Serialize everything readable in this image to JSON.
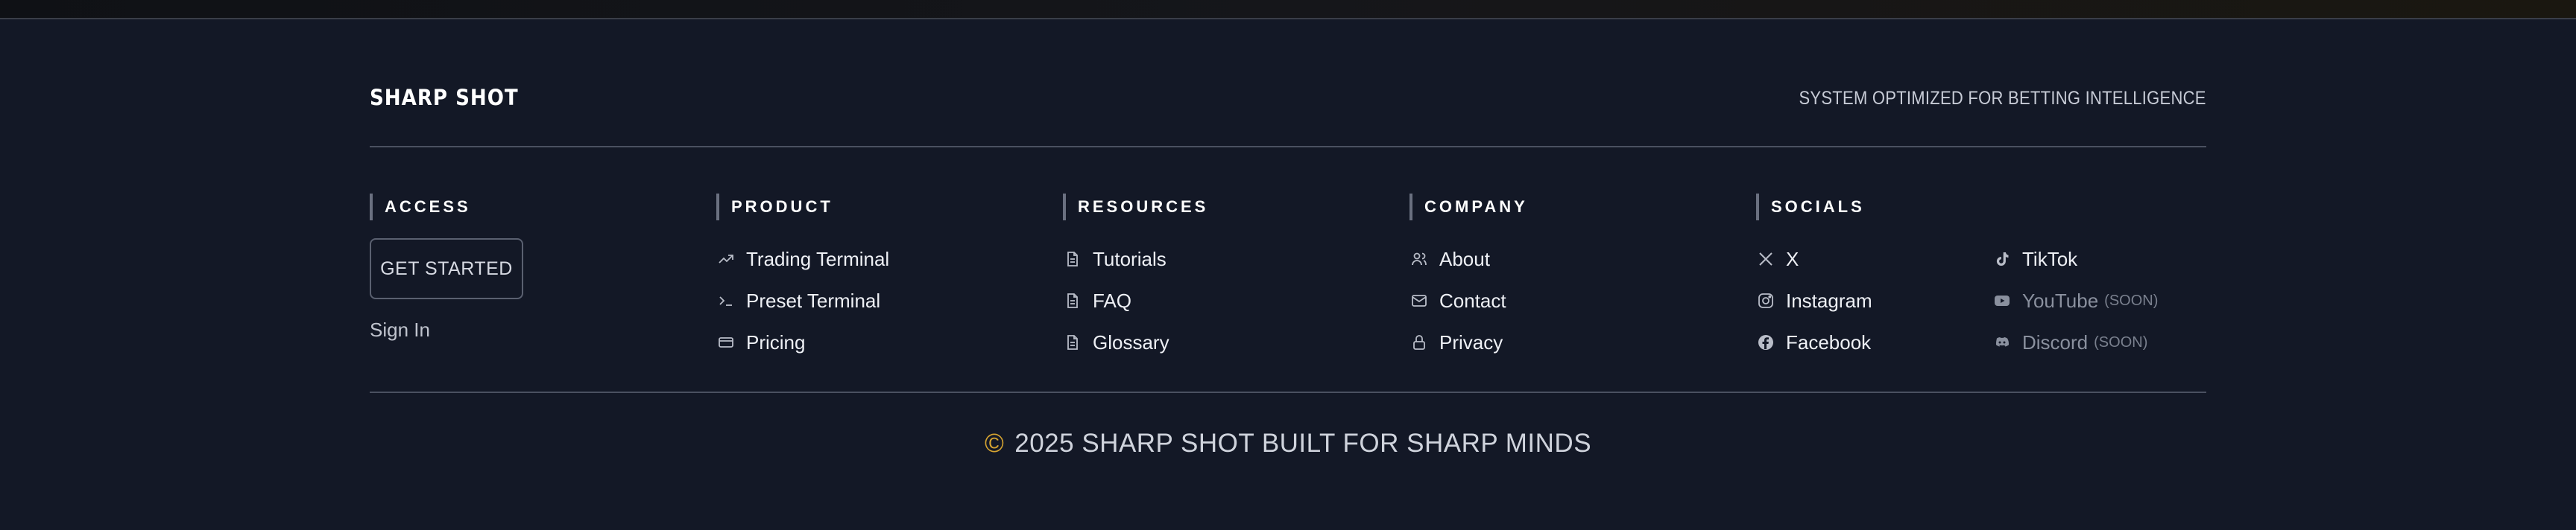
{
  "brand": {
    "name": "SHARP SHOT",
    "tagline": "SYSTEM OPTIMIZED FOR BETTING INTELLIGENCE"
  },
  "access": {
    "heading": "ACCESS",
    "cta_label": "GET STARTED",
    "signin_label": "Sign In"
  },
  "product": {
    "heading": "PRODUCT",
    "items": [
      {
        "label": "Trading Terminal",
        "icon": "trending-up-icon"
      },
      {
        "label": "Preset Terminal",
        "icon": "terminal-icon"
      },
      {
        "label": "Pricing",
        "icon": "credit-card-icon"
      }
    ]
  },
  "resources": {
    "heading": "RESOURCES",
    "items": [
      {
        "label": "Tutorials",
        "icon": "document-icon"
      },
      {
        "label": "FAQ",
        "icon": "document-icon"
      },
      {
        "label": "Glossary",
        "icon": "document-icon"
      }
    ]
  },
  "company": {
    "heading": "COMPANY",
    "items": [
      {
        "label": "About",
        "icon": "users-icon"
      },
      {
        "label": "Contact",
        "icon": "mail-icon"
      },
      {
        "label": "Privacy",
        "icon": "lock-icon"
      }
    ]
  },
  "socials": {
    "heading": "SOCIALS",
    "items": [
      {
        "label": "X",
        "icon": "x-icon"
      },
      {
        "label": "Instagram",
        "icon": "instagram-icon"
      },
      {
        "label": "Facebook",
        "icon": "facebook-icon"
      },
      {
        "label": "TikTok",
        "icon": "tiktok-icon"
      },
      {
        "label": "YouTube",
        "icon": "youtube-icon",
        "tag": "(SOON)"
      },
      {
        "label": "Discord",
        "icon": "discord-icon",
        "tag": "(SOON)"
      }
    ]
  },
  "footer": {
    "copyright_symbol": "©",
    "copyright_text": "2025 SHARP SHOT BUILT FOR SHARP MINDS"
  },
  "colors": {
    "background": "#131826",
    "accent": "#d6a431",
    "divider": "#4a5060"
  }
}
